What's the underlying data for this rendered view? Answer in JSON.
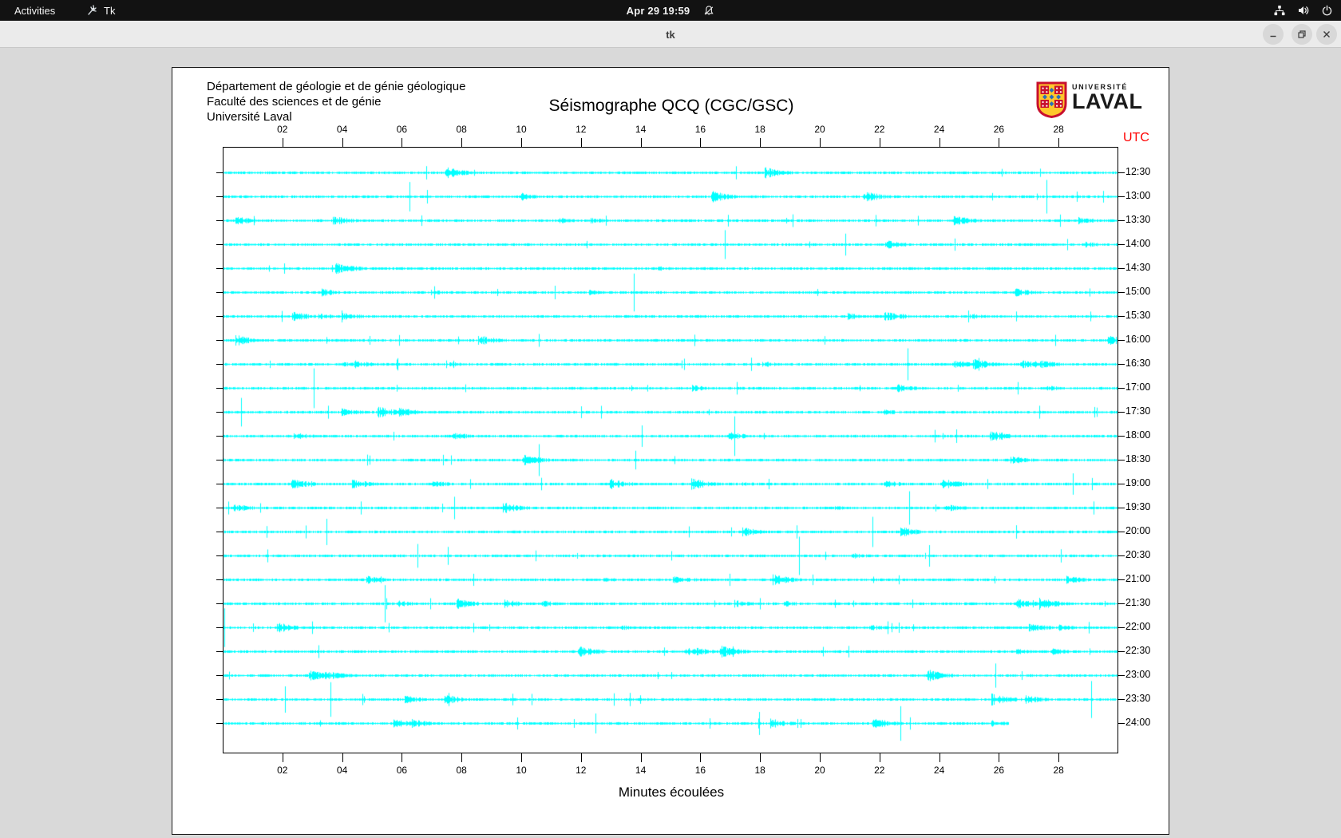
{
  "topbar": {
    "activities_label": "Activities",
    "app_name": "Tk",
    "clock": "Apr 29 19:59",
    "icons": [
      "tk-app-icon",
      "bell-muted-icon",
      "network-icon",
      "volume-icon",
      "power-icon"
    ]
  },
  "titlebar": {
    "title": "tk",
    "buttons": [
      "minimize",
      "restore",
      "close"
    ]
  },
  "canvas_header": {
    "dept": "Département de géologie et de génie géologique",
    "faculty": "Faculté des sciences et de génie",
    "university": "Université Laval"
  },
  "logo": {
    "top": "UNIVERSITÉ",
    "bottom": "LAVAL",
    "shield_red": "#c8102e",
    "shield_gold": "#ffc72c",
    "shield_blue": "#2a6ebb"
  },
  "chart_data": {
    "type": "line",
    "title": "Séismographe QCQ (CGC/GSC)",
    "xlabel": "Minutes écoulées",
    "right_axis_title": "UTC",
    "right_axis_title_color": "#ff0000",
    "trace_color": "#00ffff",
    "frame_color": "#000000",
    "x_range_minutes": [
      0,
      30
    ],
    "x_ticks": [
      "02",
      "04",
      "06",
      "08",
      "10",
      "12",
      "14",
      "16",
      "18",
      "20",
      "22",
      "24",
      "26",
      "28"
    ],
    "rows": [
      {
        "utc": "12:30",
        "end_minute": 30
      },
      {
        "utc": "13:00",
        "end_minute": 30
      },
      {
        "utc": "13:30",
        "end_minute": 30
      },
      {
        "utc": "14:00",
        "end_minute": 30
      },
      {
        "utc": "14:30",
        "end_minute": 30
      },
      {
        "utc": "15:00",
        "end_minute": 30
      },
      {
        "utc": "15:30",
        "end_minute": 30
      },
      {
        "utc": "16:00",
        "end_minute": 30
      },
      {
        "utc": "16:30",
        "end_minute": 30
      },
      {
        "utc": "17:00",
        "end_minute": 30
      },
      {
        "utc": "17:30",
        "end_minute": 30
      },
      {
        "utc": "18:00",
        "end_minute": 30
      },
      {
        "utc": "18:30",
        "end_minute": 30
      },
      {
        "utc": "19:00",
        "end_minute": 30
      },
      {
        "utc": "19:30",
        "end_minute": 30
      },
      {
        "utc": "20:00",
        "end_minute": 30
      },
      {
        "utc": "20:30",
        "end_minute": 30
      },
      {
        "utc": "21:00",
        "end_minute": 30
      },
      {
        "utc": "21:30",
        "end_minute": 30
      },
      {
        "utc": "22:00",
        "end_minute": 30
      },
      {
        "utc": "22:30",
        "end_minute": 30
      },
      {
        "utc": "23:00",
        "end_minute": 30
      },
      {
        "utc": "23:30",
        "end_minute": 30
      },
      {
        "utc": "24:00",
        "end_minute": 26.3
      }
    ]
  }
}
